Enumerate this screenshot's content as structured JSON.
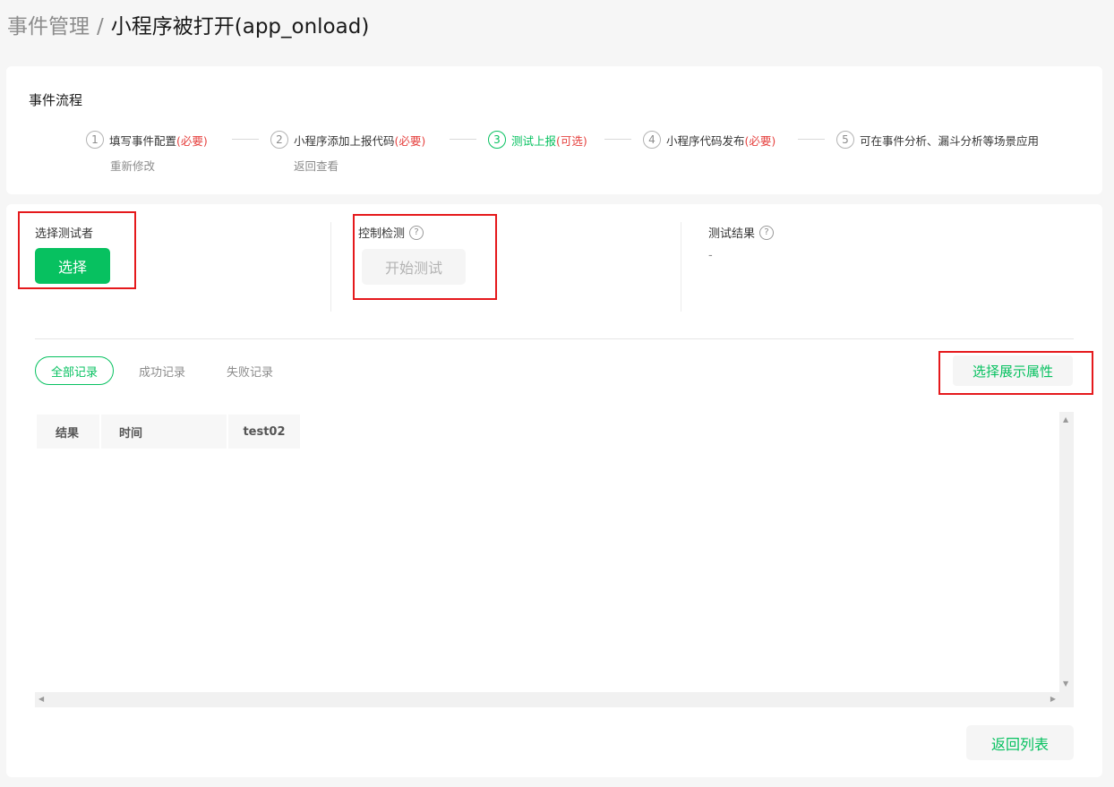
{
  "breadcrumb": {
    "parent": "事件管理",
    "separator": "/",
    "current": "小程序被打开(app_onload)"
  },
  "flow": {
    "title": "事件流程",
    "steps": [
      {
        "num": "1",
        "label": "填写事件配置 ",
        "tag": "(必要)",
        "sub": "重新修改"
      },
      {
        "num": "2",
        "label": "小程序添加上报代码",
        "tag": "(必要)",
        "sub": "返回查看"
      },
      {
        "num": "3",
        "label": "测试上报",
        "tag": "(可选)"
      },
      {
        "num": "4",
        "label": "小程序代码发布",
        "tag": "(必要)"
      },
      {
        "num": "5",
        "label": "可在事件分析、漏斗分析等场景应用"
      }
    ]
  },
  "tester": {
    "label": "选择测试者",
    "button": "选择"
  },
  "control": {
    "label": "控制检测",
    "button": "开始测试"
  },
  "result": {
    "label": "测试结果",
    "value": "-"
  },
  "help_icon": "?",
  "tabs": [
    {
      "label": "全部记录",
      "active": true
    },
    {
      "label": "成功记录",
      "active": false
    },
    {
      "label": "失败记录",
      "active": false
    }
  ],
  "attr_button": "选择展示属性",
  "table": {
    "columns": [
      "结果",
      "时间",
      "test02"
    ],
    "rows": []
  },
  "back_button": "返回列表",
  "colors": {
    "primary": "#07c160",
    "required": "#e64340",
    "highlight_box": "#e5191c"
  },
  "icons": {
    "help": "question-circle-icon",
    "scroll_up": "arrow-up-icon",
    "scroll_down": "arrow-down-icon",
    "scroll_left": "arrow-left-icon",
    "scroll_right": "arrow-right-icon"
  }
}
